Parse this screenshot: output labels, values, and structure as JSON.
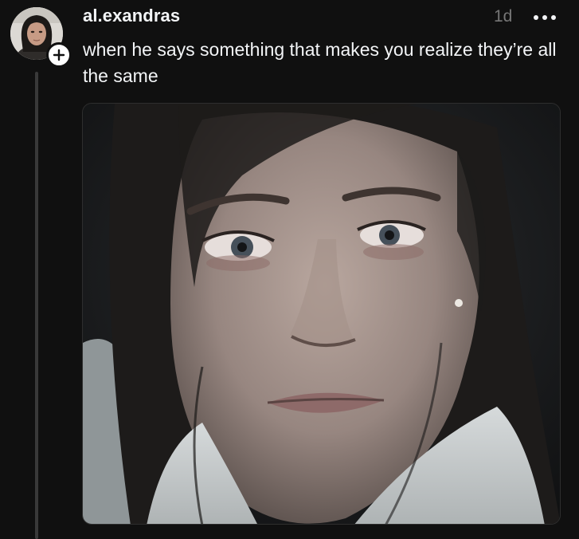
{
  "post": {
    "username": "al.exandras",
    "timestamp": "1d",
    "caption": "when he says something that makes you realize they’re all the same"
  },
  "icons": {
    "follow": "plus-icon",
    "more": "more-horizontal-icon"
  },
  "colors": {
    "background": "#101010",
    "text_primary": "#f3f5f7",
    "text_secondary": "#777777",
    "thread_line": "#393939"
  }
}
